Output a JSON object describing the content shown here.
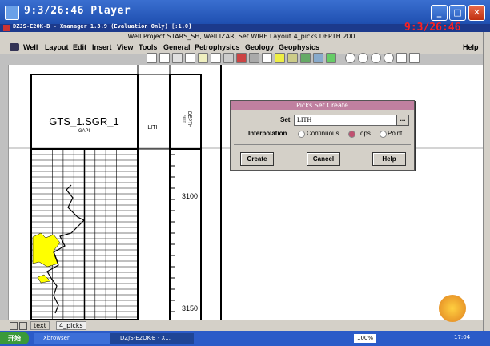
{
  "player": {
    "title": "9:3/26:46 Player",
    "timer": "9:3/26:46",
    "min_label": "_",
    "max_label": "□",
    "close_label": "✕"
  },
  "xmanager": {
    "title": "DZJS-E2OK-B - Xmanager 1.3.9 (Evaluation Only) [:1.0]"
  },
  "window_info": "Well   Project STARS_SH, Well IZAR, Set WIRE   Layout 4_picks  DEPTH 200",
  "menu": [
    "Well",
    "Layout",
    "Edit",
    "Insert",
    "View",
    "Tools",
    "General",
    "Petrophysics",
    "Geology",
    "Geophysics"
  ],
  "help": "Help",
  "log": {
    "curve_name": "GTS_1.SGR_1",
    "curve_unit": "GAPI",
    "lith_label": "LITH",
    "depth_label": "DEPTH",
    "depth_unit": "FEET",
    "depths": [
      "3100",
      "3150"
    ]
  },
  "dialog": {
    "title": "Picks Set Create",
    "set_label": "Set",
    "set_value": "LITH",
    "browse_label": "...",
    "interpolation_label": "Interpolation",
    "options": [
      {
        "label": "Continuous",
        "selected": false
      },
      {
        "label": "Tops",
        "selected": true
      },
      {
        "label": "Point",
        "selected": false
      }
    ],
    "create": "Create",
    "cancel": "Cancel",
    "help": "Help"
  },
  "tabs": [
    "text",
    "4_picks"
  ],
  "taskbar": {
    "start": "开始",
    "items": [
      "Xbrowser",
      "DZJS-E2OK-B - X..."
    ],
    "zoom": "100%",
    "clock": "17:04"
  },
  "colors": {
    "title_bar": "#2b5fc0",
    "dialog_title": "#c080a0",
    "fill": "#ffff00"
  }
}
